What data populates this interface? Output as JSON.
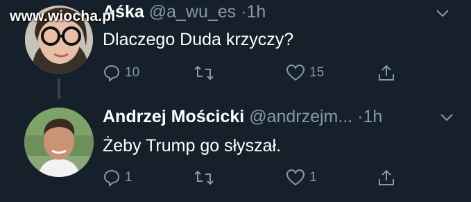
{
  "watermark": "www.wiocha.pl",
  "tweets": [
    {
      "name": "Aśka",
      "handle": "@a_wu_es",
      "dot": "·",
      "time": "1h",
      "text": "Dlaczego Duda krzyczy?",
      "reply_count": "10",
      "retweet_count": "",
      "like_count": "15",
      "avatar_icon": "avatar-woman-glasses",
      "menu_icon": "chevron-down-icon"
    },
    {
      "name": "Andrzej Mościcki",
      "handle": "@andrzejm...",
      "dot": "·",
      "time": "1h",
      "text": "Żeby Trump go słyszał.",
      "reply_count": "1",
      "retweet_count": "",
      "like_count": "1",
      "avatar_icon": "avatar-man-outdoors",
      "menu_icon": "chevron-down-icon"
    }
  ],
  "colors": {
    "background": "#15202b",
    "secondary_text": "#8899a6",
    "thread_line": "#38444d"
  }
}
